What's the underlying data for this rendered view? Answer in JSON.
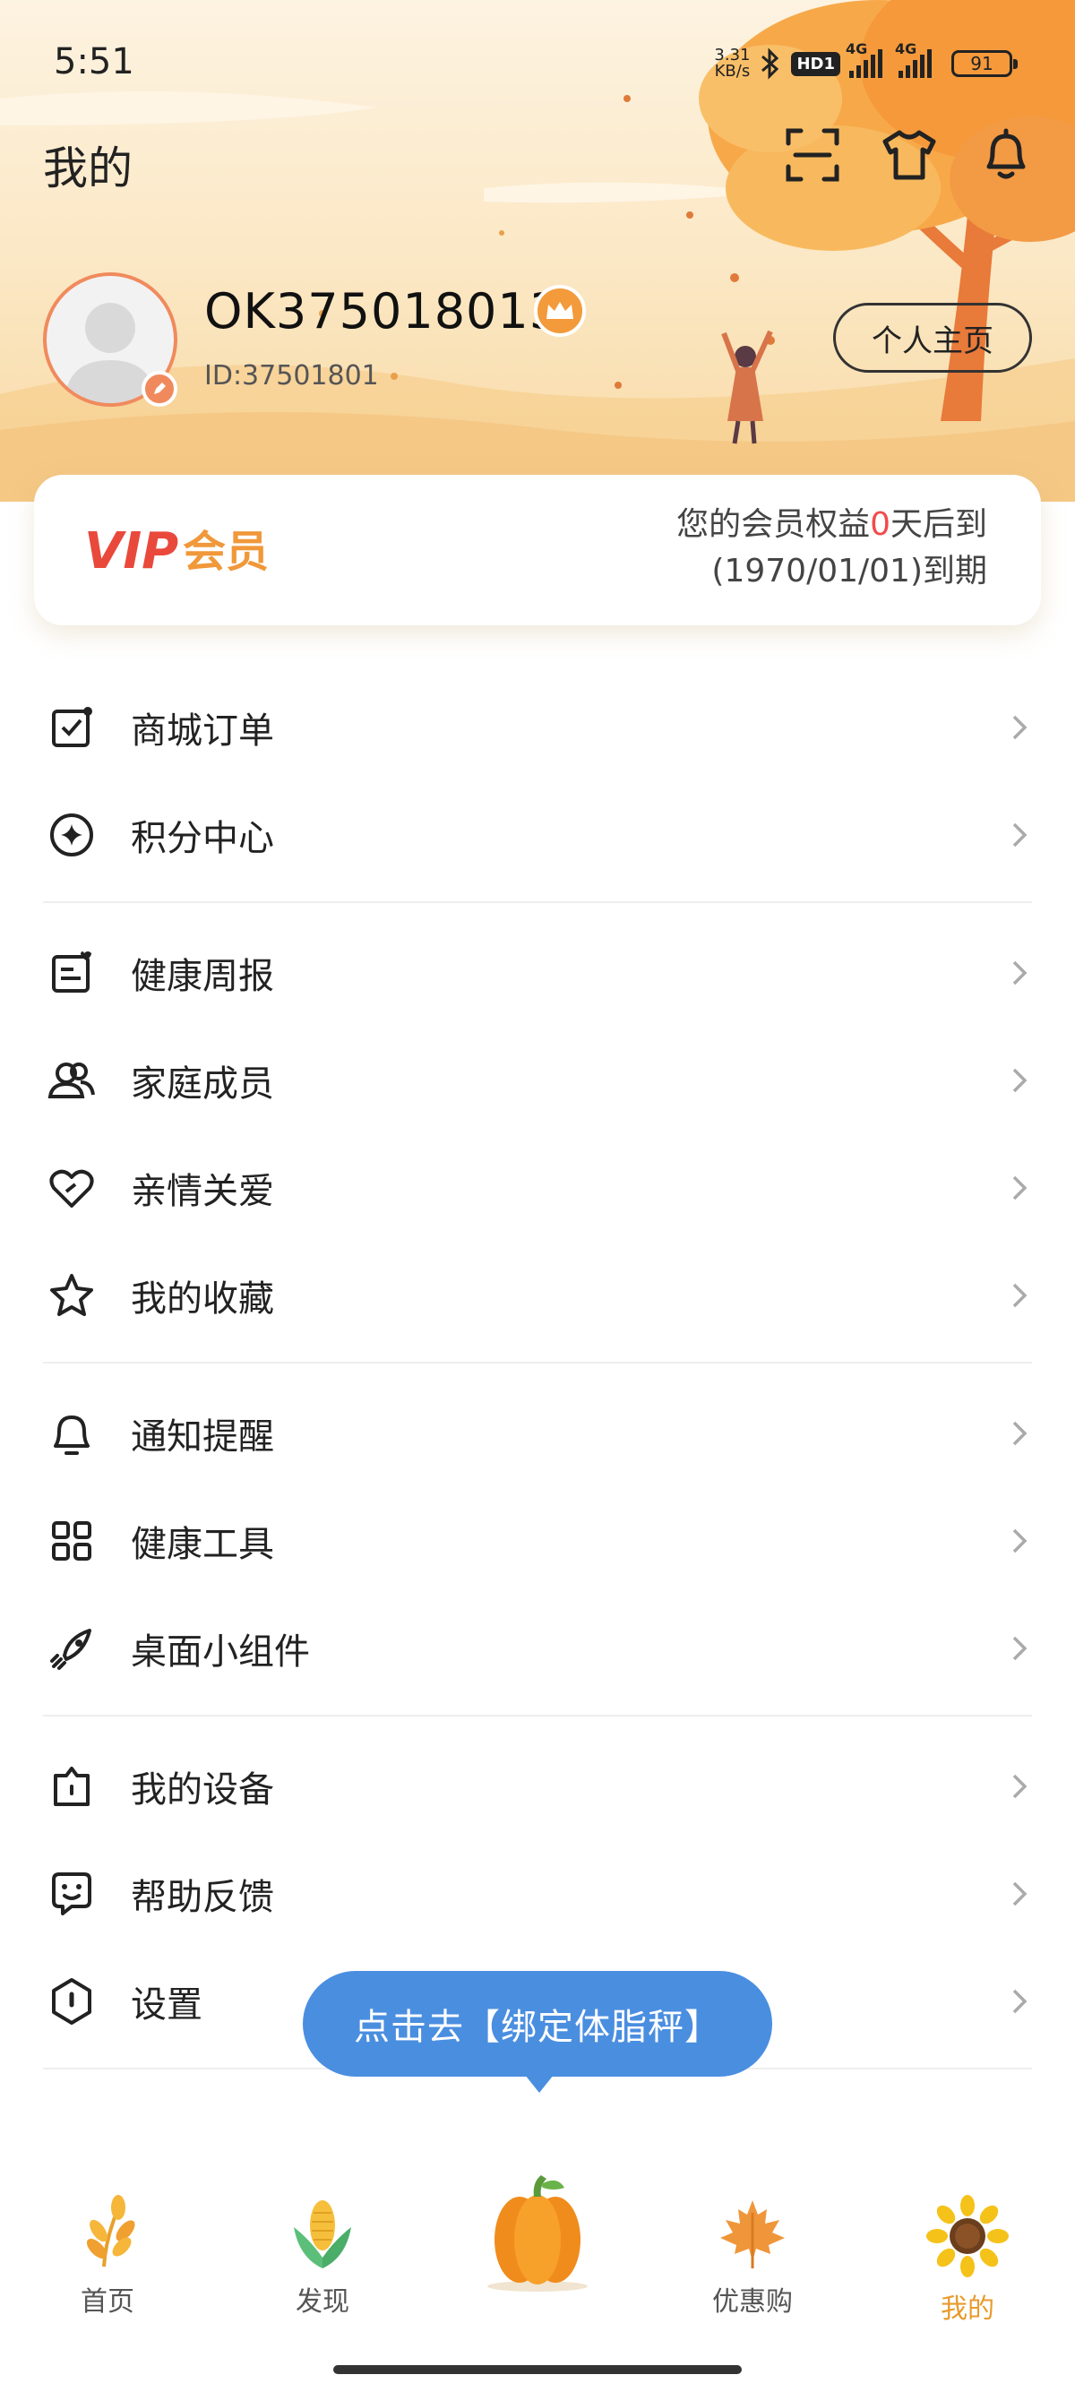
{
  "status_bar": {
    "time": "5:51",
    "net_speed_value": "3.31",
    "net_speed_unit": "KB/s",
    "hd_badge": "HD1",
    "network_label_1": "4G",
    "network_label_2": "4G",
    "battery": "91"
  },
  "header": {
    "title": "我的",
    "icons": [
      "scan-icon",
      "tshirt-icon",
      "bell-icon"
    ]
  },
  "profile": {
    "username": "OK375018013",
    "user_id": "ID:37501801",
    "homepage_button": "个人主页"
  },
  "vip": {
    "logo_text": "VIP会员",
    "line1_prefix": "您的会员权益",
    "days": "0",
    "line1_suffix": "天后到",
    "line2": "(1970/01/01)到期"
  },
  "menu_groups": [
    [
      {
        "label": "商城订单",
        "icon": "order-icon"
      },
      {
        "label": "积分中心",
        "icon": "points-icon"
      }
    ],
    [
      {
        "label": "健康周报",
        "icon": "report-icon"
      },
      {
        "label": "家庭成员",
        "icon": "family-icon"
      },
      {
        "label": "亲情关爱",
        "icon": "heart-icon"
      },
      {
        "label": "我的收藏",
        "icon": "star-icon"
      }
    ],
    [
      {
        "label": "通知提醒",
        "icon": "notification-icon"
      },
      {
        "label": "健康工具",
        "icon": "tools-icon"
      },
      {
        "label": "桌面小组件",
        "icon": "widget-icon"
      }
    ],
    [
      {
        "label": "我的设备",
        "icon": "device-icon"
      },
      {
        "label": "帮助反馈",
        "icon": "feedback-icon"
      },
      {
        "label": "设置",
        "icon": "settings-icon"
      }
    ]
  ],
  "tooltip": "点击去【绑定体脂秤】",
  "bottom_nav": [
    {
      "label": "首页",
      "icon": "wheat-icon"
    },
    {
      "label": "发现",
      "icon": "corn-icon"
    },
    {
      "label": "",
      "icon": "pumpkin-icon"
    },
    {
      "label": "优惠购",
      "icon": "maple-leaf-icon"
    },
    {
      "label": "我的",
      "icon": "sunflower-icon",
      "active": true
    }
  ],
  "colors": {
    "accent_orange": "#f08a5d",
    "active_nav": "#e89a2c",
    "tooltip_blue": "#4a8ee0",
    "vip_red": "#f24b4b"
  }
}
